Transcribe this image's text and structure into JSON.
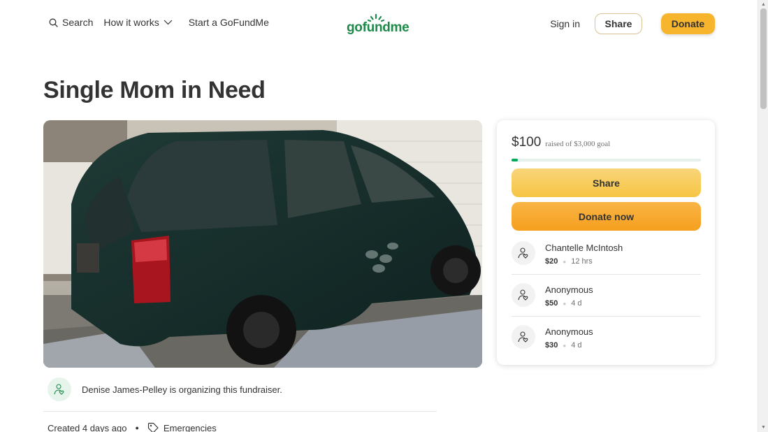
{
  "header": {
    "search_label": "Search",
    "how_it_works_label": "How it works",
    "start_label": "Start a GoFundMe",
    "logo_text": "gofundme",
    "signin_label": "Sign in",
    "share_label": "Share",
    "donate_label": "Donate"
  },
  "campaign": {
    "title": "Single Mom in Need",
    "photo_icon": "photo-minivan"
  },
  "card": {
    "raised_amount": "$100",
    "raised_text": "raised of $3,000 goal",
    "progress_fraction": 0.033,
    "share_label": "Share",
    "donate_label": "Donate now",
    "donations": [
      {
        "name": "Chantelle McIntosh",
        "amount": "$20",
        "time": "12 hrs"
      },
      {
        "name": "Anonymous",
        "amount": "$50",
        "time": "4 d"
      },
      {
        "name": "Anonymous",
        "amount": "$30",
        "time": "4 d"
      }
    ]
  },
  "organizer": {
    "text": "Denise James-Pelley is organizing this fundraiser."
  },
  "meta": {
    "created": "Created 4 days ago",
    "category": "Emergencies"
  },
  "colors": {
    "brand_green": "#02a95c",
    "donate_orange": "#f7b52d"
  }
}
